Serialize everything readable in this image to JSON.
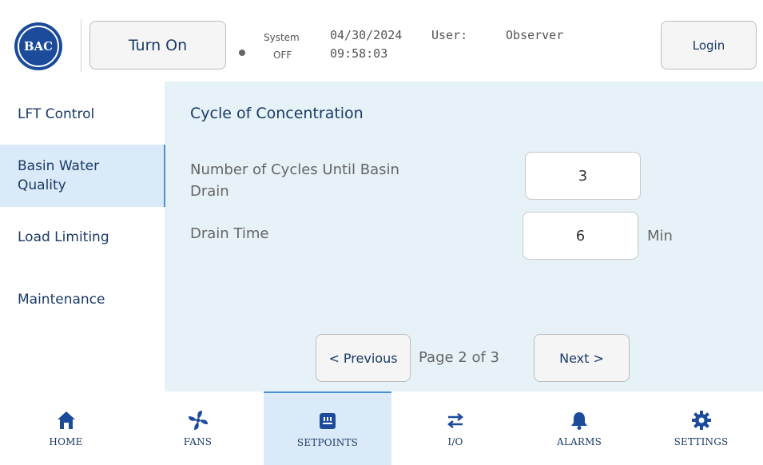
{
  "header": {
    "logo_text": "BAC",
    "turn_on_label": "Turn On",
    "system_label": "System",
    "system_state": "OFF",
    "date": "04/30/2024",
    "time": "09:58:03",
    "user_label": "User:",
    "user_name": "Observer",
    "login_label": "Login"
  },
  "sidebar": {
    "items": [
      {
        "label": "LFT Control"
      },
      {
        "label": "Basin Water Quality"
      },
      {
        "label": "Load Limiting"
      },
      {
        "label": "Maintenance"
      }
    ]
  },
  "main": {
    "title": "Cycle of Concentration",
    "fields": [
      {
        "label": "Number of Cycles Until Basin Drain",
        "value": "3",
        "unit": ""
      },
      {
        "label": "Drain Time",
        "value": "6",
        "unit": "Min"
      }
    ],
    "pager": {
      "previous_label": "< Previous",
      "page_text": "Page 2 of 3",
      "next_label": "Next >"
    }
  },
  "bottom_nav": {
    "items": [
      {
        "label": "HOME",
        "icon": "home-icon"
      },
      {
        "label": "FANS",
        "icon": "fan-icon"
      },
      {
        "label": "SETPOINTS",
        "icon": "setpoints-icon"
      },
      {
        "label": "I/O",
        "icon": "io-arrows-icon"
      },
      {
        "label": "ALARMS",
        "icon": "bell-icon"
      },
      {
        "label": "SETTINGS",
        "icon": "gear-icon"
      }
    ]
  },
  "colors": {
    "accent": "#1b4b9a",
    "content_bg": "#e6f2f7",
    "active_bg": "#dbeaf8",
    "active_border": "#4a90d9",
    "text": "#1a3a66"
  }
}
